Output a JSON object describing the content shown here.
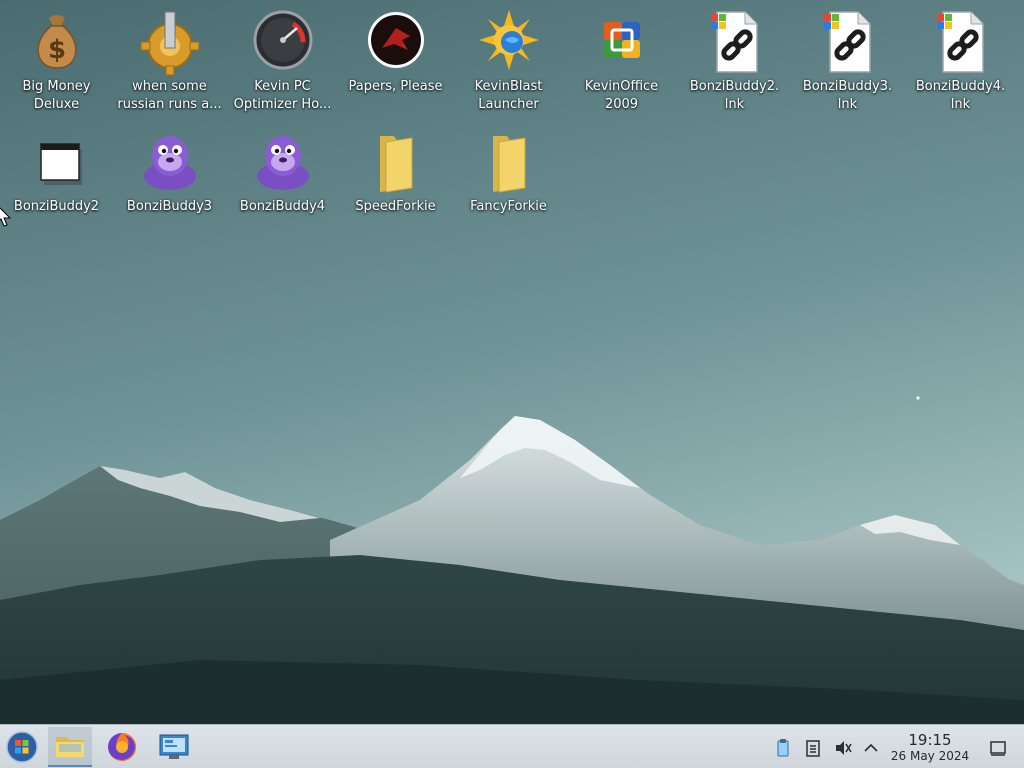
{
  "desktop": {
    "icons": [
      {
        "label": "Big Money\nDeluxe",
        "icon": "money-bag-icon"
      },
      {
        "label": "when some\nrussian runs a...",
        "icon": "gear-wheel-icon"
      },
      {
        "label": "Kevin PC\nOptimizer Ho...",
        "icon": "speedometer-icon"
      },
      {
        "label": "Papers, Please",
        "icon": "papers-please-emblem-icon"
      },
      {
        "label": "KevinBlast\nLauncher",
        "icon": "sun-globe-icon"
      },
      {
        "label": "KevinOffice\n2009",
        "icon": "office-logo-icon"
      },
      {
        "label": "BonziBuddy2.\nlnk",
        "icon": "shortcut-link-icon"
      },
      {
        "label": "BonziBuddy3.\nlnk",
        "icon": "shortcut-link-icon"
      },
      {
        "label": "BonziBuddy4.\nlnk",
        "icon": "shortcut-link-icon"
      },
      {
        "label": "BonziBuddy2",
        "icon": "application-window-icon"
      },
      {
        "label": "BonziBuddy3",
        "icon": "purple-gorilla-icon"
      },
      {
        "label": "BonziBuddy4",
        "icon": "purple-gorilla-icon"
      },
      {
        "label": "SpeedForkie",
        "icon": "folder-icon"
      },
      {
        "label": "FancyForkie",
        "icon": "folder-icon"
      }
    ]
  },
  "taskbar": {
    "start_button": "start-orb-icon",
    "pinned": [
      {
        "name": "file-manager-icon",
        "active": true
      },
      {
        "name": "firefox-icon",
        "active": false
      },
      {
        "name": "system-monitor-icon",
        "active": false
      }
    ],
    "tray": [
      "clipboard-tray-icon",
      "notes-tray-icon",
      "volume-muted-icon",
      "chevron-up-icon"
    ],
    "clock": {
      "time": "19:15",
      "date": "26 May 2024"
    },
    "show_desktop": "show-desktop-icon"
  },
  "colors": {
    "sky_top": "#4a6f72",
    "sky_horizon": "#9fbfbf",
    "mountain_dark": "#2a3f40",
    "snow": "#e8eef0",
    "taskbar": "#d6dce1"
  }
}
